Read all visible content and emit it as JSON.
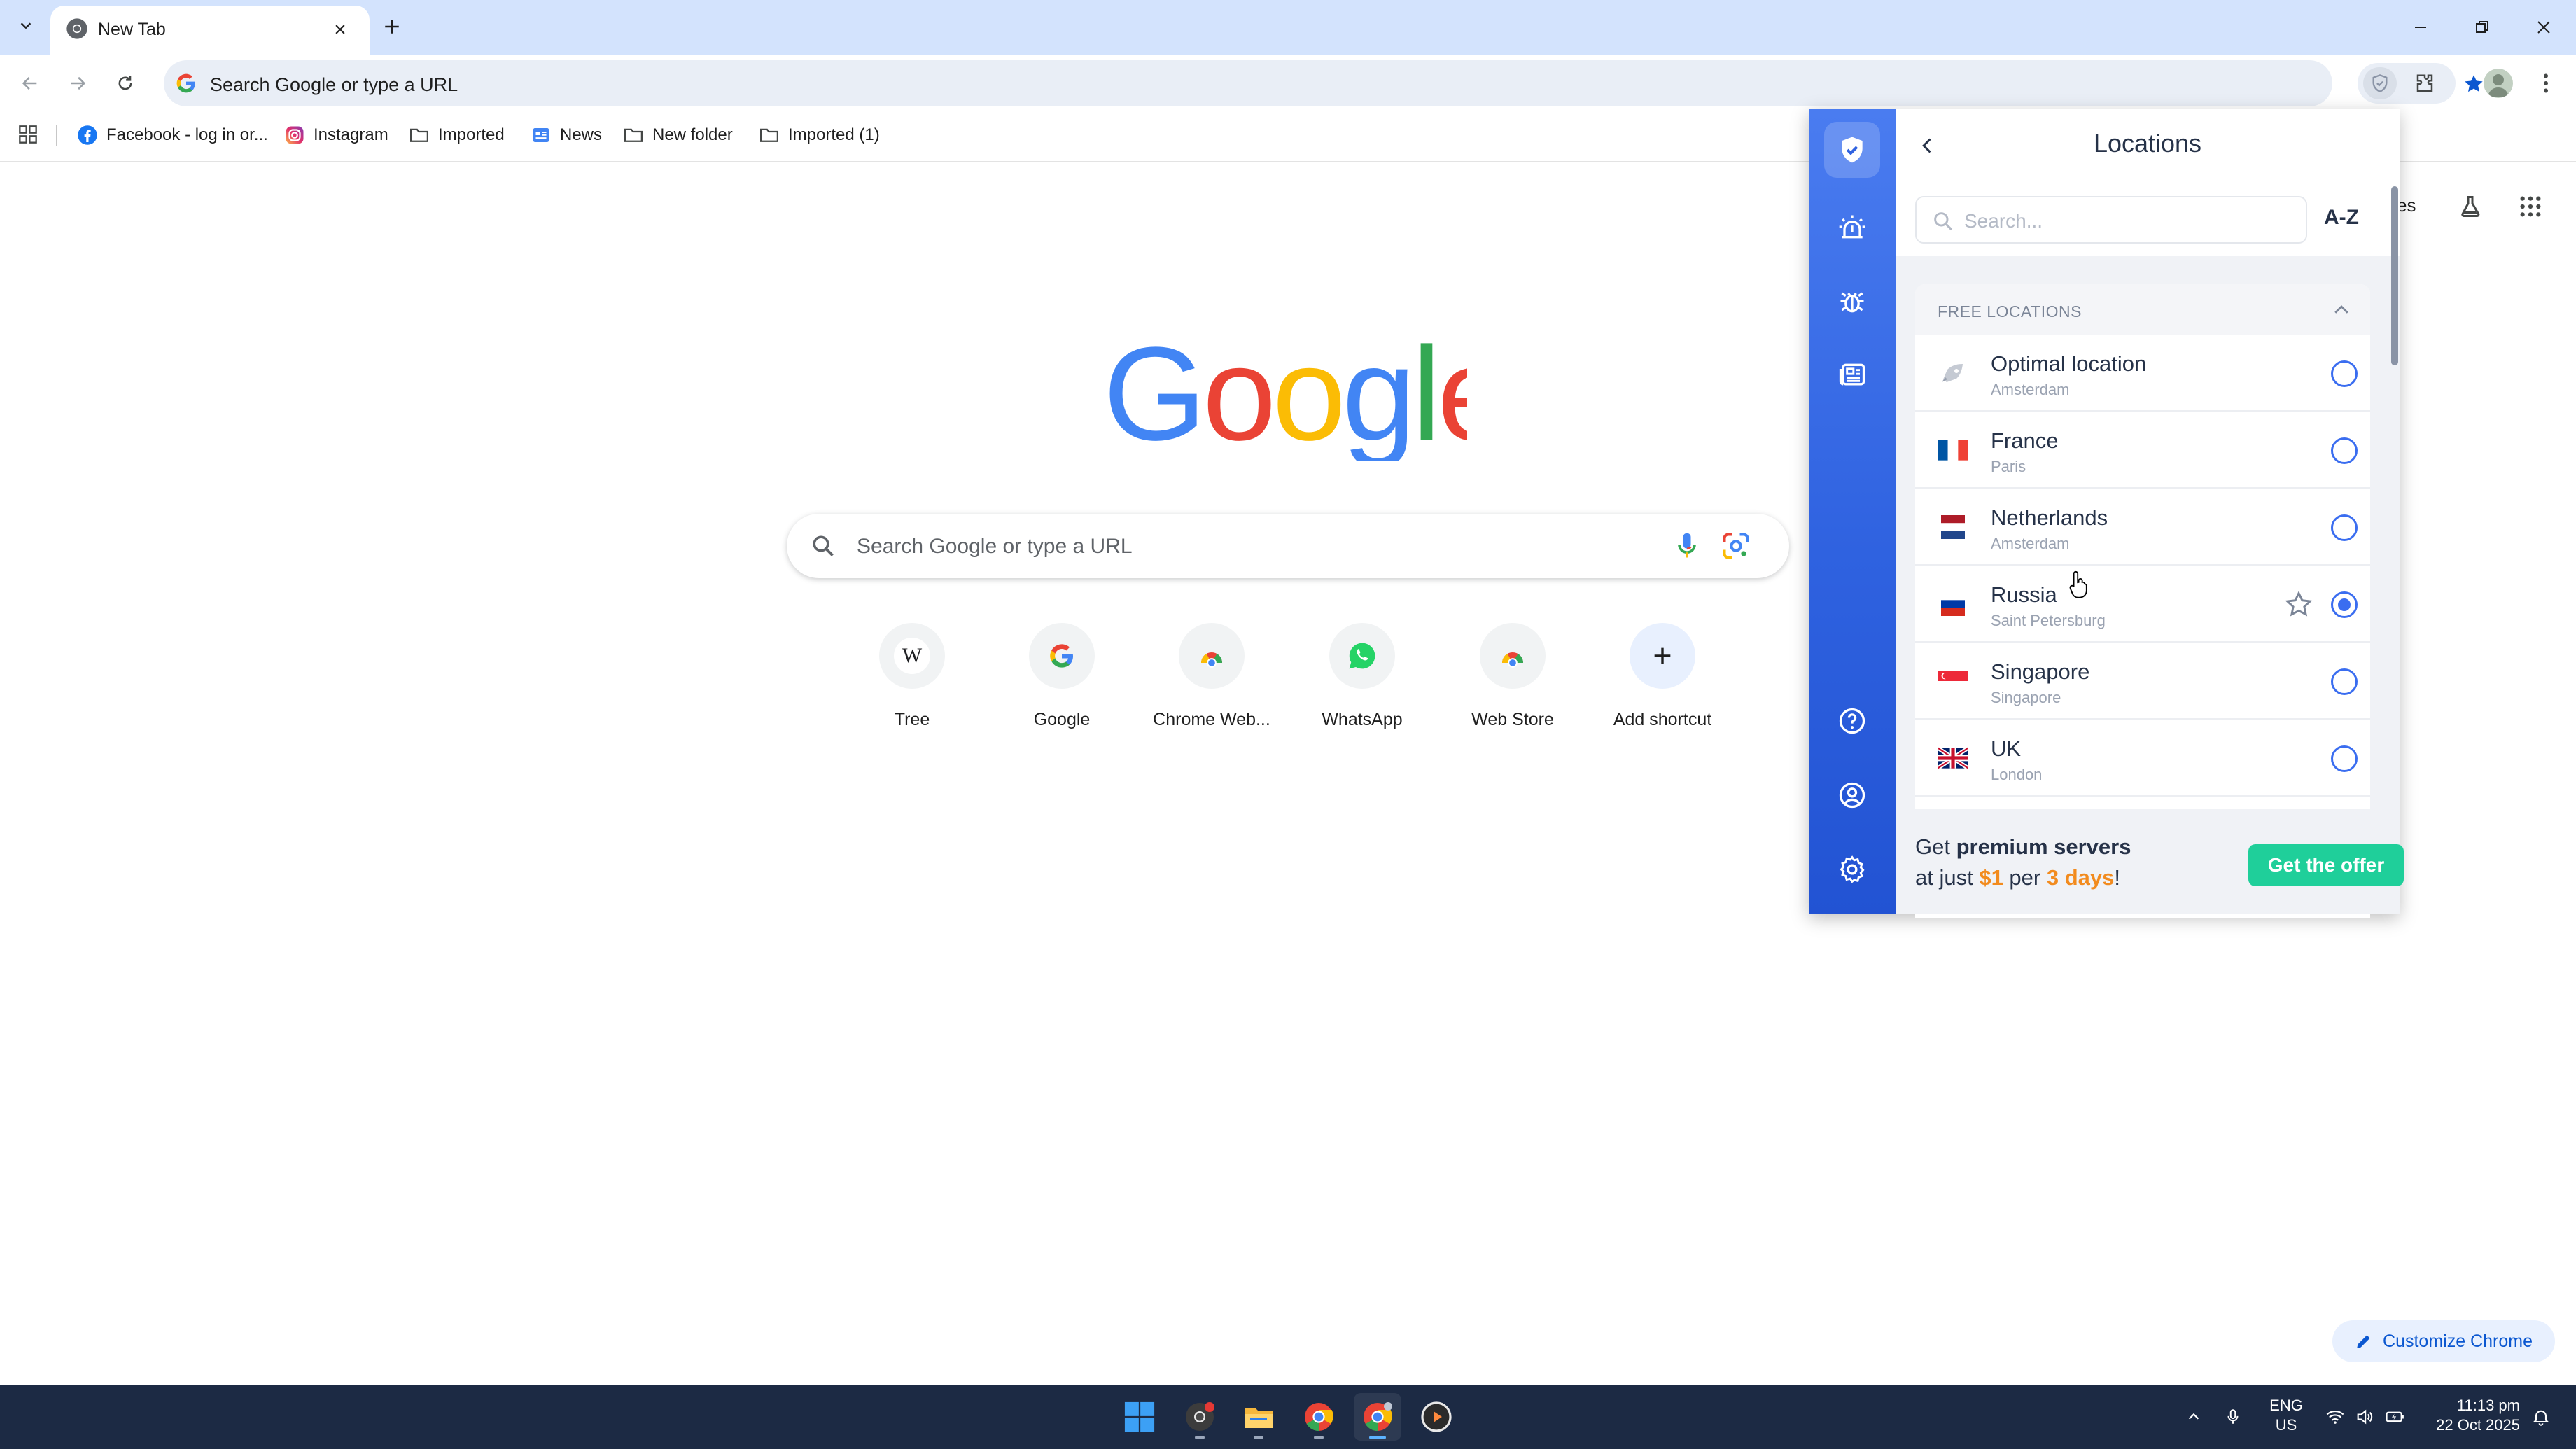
{
  "browser": {
    "tab": {
      "title": "New Tab"
    },
    "omnibox": {
      "placeholder": "Search Google or type a URL"
    },
    "bookmarks": [
      {
        "label": "Facebook - log in or...",
        "icon": "facebook-icon"
      },
      {
        "label": "Instagram",
        "icon": "instagram-icon"
      },
      {
        "label": "Imported",
        "icon": "folder-icon"
      },
      {
        "label": "News",
        "icon": "news-icon"
      },
      {
        "label": "New folder",
        "icon": "folder-icon"
      },
      {
        "label": "Imported (1)",
        "icon": "folder-icon"
      }
    ]
  },
  "ntp": {
    "logo_text": "Google",
    "search_placeholder": "Search Google or type a URL",
    "partial_link_text": "es",
    "shortcuts": [
      {
        "label": "Tree",
        "icon": "wikipedia-icon"
      },
      {
        "label": "Google",
        "icon": "google-icon"
      },
      {
        "label": "Chrome Web...",
        "icon": "chrome-web-store-icon"
      },
      {
        "label": "WhatsApp",
        "icon": "whatsapp-icon"
      },
      {
        "label": "Web Store",
        "icon": "chrome-web-store-icon"
      },
      {
        "label": "Add shortcut",
        "icon": "plus-icon"
      }
    ],
    "customize_label": "Customize Chrome"
  },
  "vpn": {
    "title": "Locations",
    "search_placeholder": "Search...",
    "sort_label": "A-Z",
    "section_label": "FREE LOCATIONS",
    "locations": [
      {
        "name": "Optimal location",
        "city": "Amsterdam",
        "selected": false,
        "flag": "rocket"
      },
      {
        "name": "France",
        "city": "Paris",
        "selected": false,
        "flag": "fr"
      },
      {
        "name": "Netherlands",
        "city": "Amsterdam",
        "selected": false,
        "flag": "nl"
      },
      {
        "name": "Russia",
        "city": "Saint Petersburg",
        "selected": true,
        "flag": "ru"
      },
      {
        "name": "Singapore",
        "city": "Singapore",
        "selected": false,
        "flag": "sg"
      },
      {
        "name": "UK",
        "city": "London",
        "selected": false,
        "flag": "uk"
      }
    ],
    "promo": {
      "pre": "Get ",
      "bold": "premium servers",
      "line2_pre": "at just ",
      "price": "$1",
      "mid": " per ",
      "period": "3 days",
      "end": "!",
      "button": "Get the offer"
    },
    "colors": {
      "rail": "#2f62e0",
      "accent": "#3a6df0",
      "cta": "#1fcf9a",
      "highlight": "#f28b1e"
    }
  },
  "taskbar": {
    "lang_line1": "ENG",
    "lang_line2": "US",
    "time": "11:13 pm",
    "date": "22 Oct 2025"
  }
}
